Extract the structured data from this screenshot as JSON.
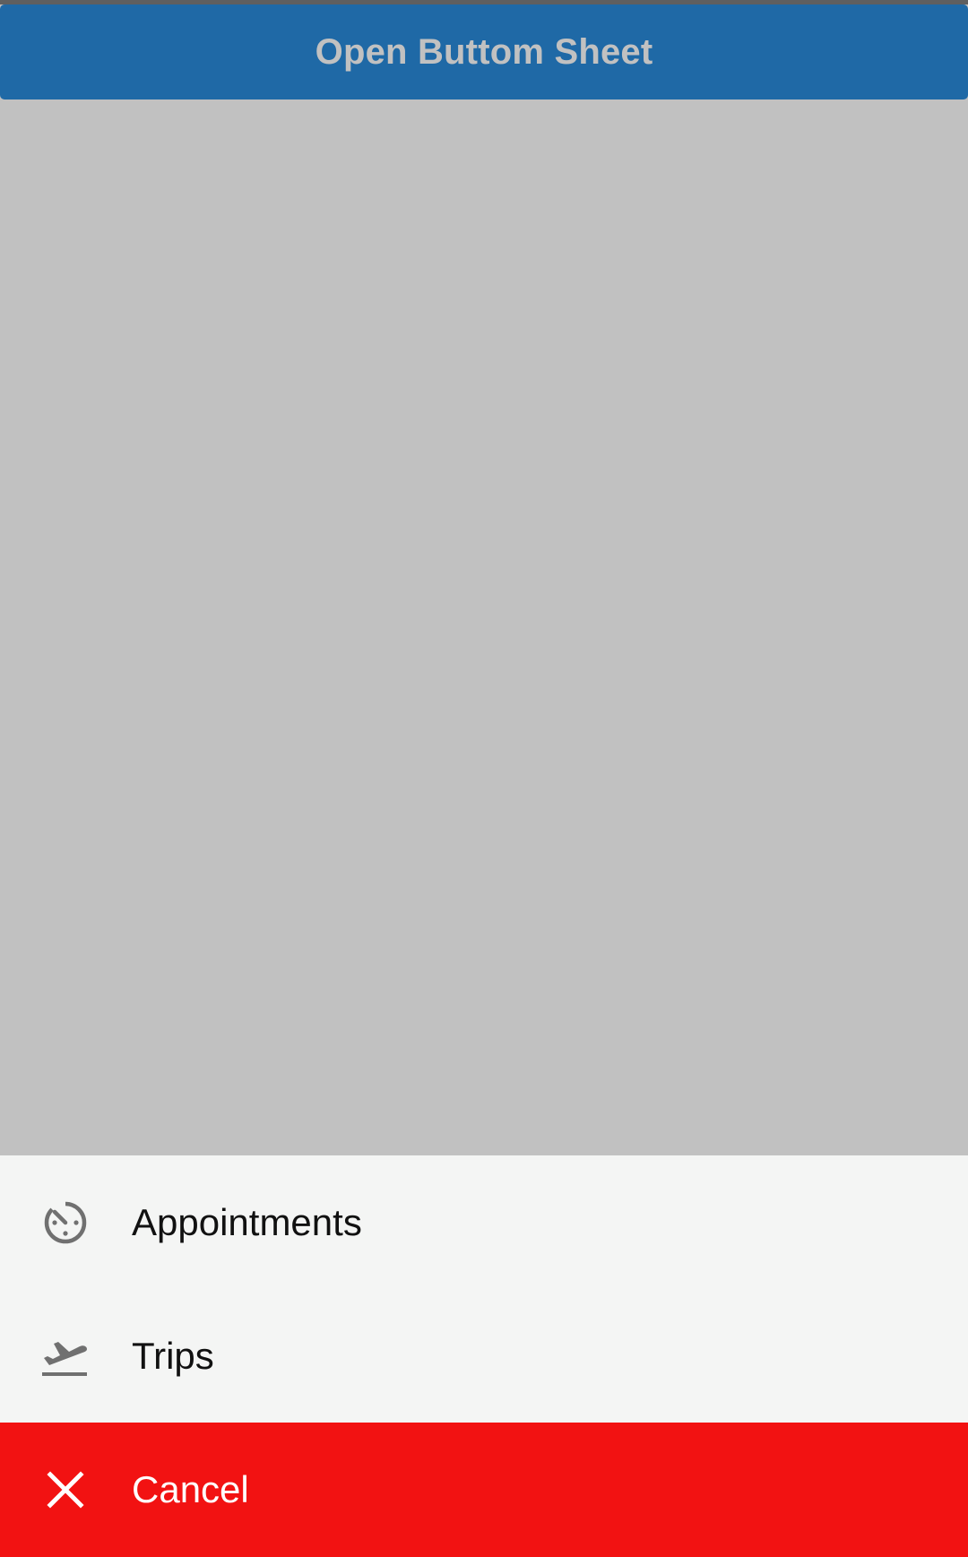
{
  "header": {
    "button_label": "Open Buttom Sheet",
    "button_color": "#1f69a6"
  },
  "bottom_sheet": {
    "background": "#f4f5f4",
    "items": [
      {
        "label": "Appointments",
        "icon": "timer-icon"
      },
      {
        "label": "Trips",
        "icon": "flight-takeoff-icon"
      },
      {
        "label": "Cancel",
        "icon": "close-icon",
        "background": "#f21212"
      }
    ]
  },
  "colors": {
    "scrim": "#c1c1c1",
    "icon_gray": "#707070"
  }
}
